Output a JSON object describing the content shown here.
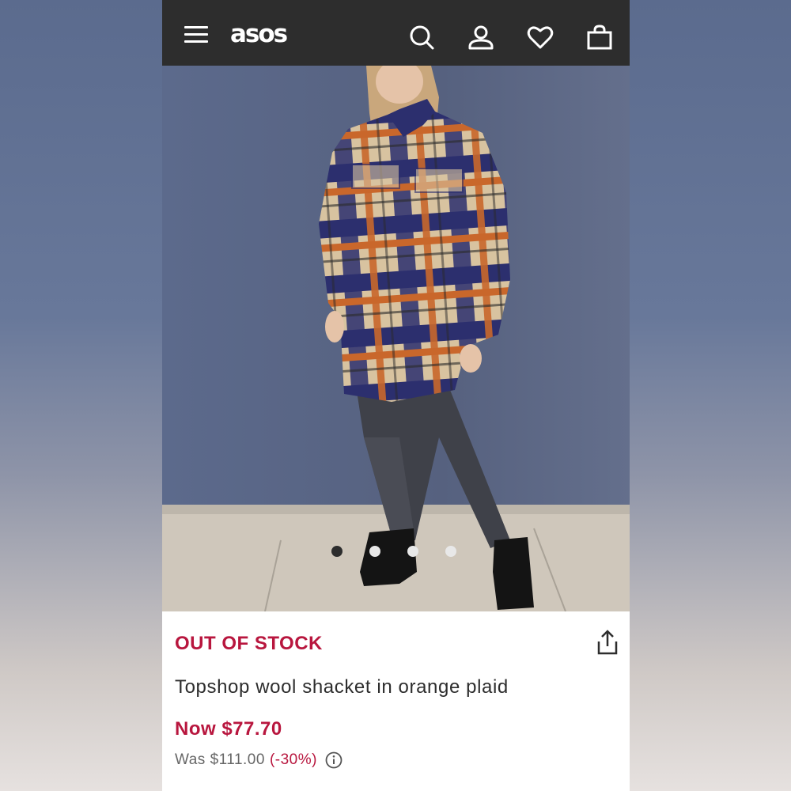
{
  "header": {
    "logo": "asos",
    "icons": [
      "menu-icon",
      "search-icon",
      "account-icon",
      "heart-icon",
      "bag-icon"
    ]
  },
  "gallery": {
    "slide_count": 4,
    "active_index": 0
  },
  "product": {
    "stock_status": "OUT OF STOCK",
    "title": "Topshop wool shacket in orange plaid",
    "now_price": "Now $77.70",
    "was_price": "Was $111.00",
    "discount": "(-30%)"
  },
  "colors": {
    "header_bg": "#2d2d2d",
    "accent": "#b8163e",
    "text": "#2d2d2d"
  }
}
